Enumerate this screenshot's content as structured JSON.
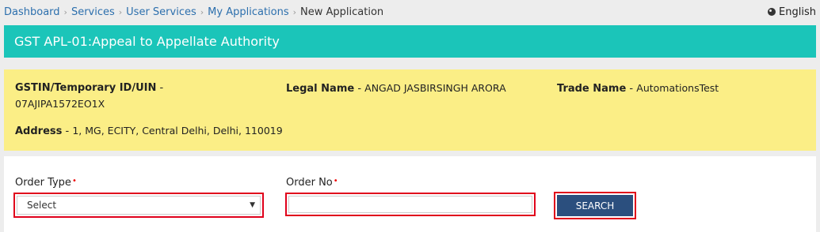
{
  "breadcrumb": {
    "items": [
      "Dashboard",
      "Services",
      "User Services",
      "My Applications"
    ],
    "current": "New Application"
  },
  "language": {
    "label": "English",
    "icon": "globe-icon"
  },
  "title": "GST APL-01:Appeal to Appellate Authority",
  "taxpayer": {
    "gstin_label": "GSTIN/Temporary ID/UIN",
    "gstin_value": "07AJIPA1572EO1X",
    "legal_name_label": "Legal Name",
    "legal_name_value": "ANGAD JASBIRSINGH ARORA",
    "trade_name_label": "Trade Name",
    "trade_name_value": "AutomationsTest",
    "address_label": "Address",
    "address_value": "1, MG, ECITY, Central Delhi, Delhi, 110019"
  },
  "form": {
    "order_type_label": "Order Type",
    "order_type_selected": "Select",
    "order_no_label": "Order No",
    "order_no_value": "",
    "required_marker": "•",
    "search_button": "SEARCH"
  },
  "colors": {
    "title_bg": "#1bc5b9",
    "info_bg": "#fbee86",
    "button_bg": "#2b4f7e",
    "highlight_border": "#e0001b",
    "link": "#2c6fad"
  }
}
